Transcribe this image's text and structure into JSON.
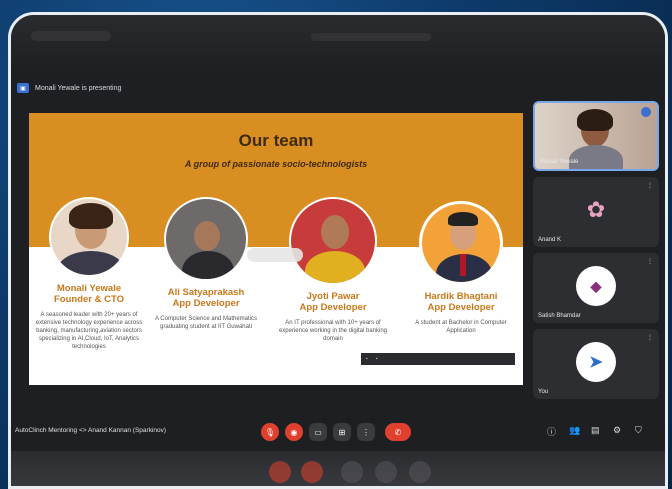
{
  "presenting_banner": "Monali Yewale is presenting",
  "slide": {
    "title": "Our team",
    "subtitle": "A group of passionate socio-technologists",
    "members": [
      {
        "name": "Monali Yewale",
        "role": "Founder & CTO",
        "bio": "A seasoned leader with 20+ years of extensive technology experience across banking, manufacturing,aviation sectors specializing in AI,Cloud, IoT, Analytics technologies"
      },
      {
        "name": "Ali Satyaprakash",
        "role": "App Developer",
        "bio": "A Computer Science and Mathematics graduating student at IIT Guwahati"
      },
      {
        "name": "Jyoti Pawar",
        "role": "App Developer",
        "bio": "An IT professional with 10+ years of experience working in the digital banking domain"
      },
      {
        "name": "Hardik Bhagtani",
        "role": "App Developer",
        "bio": "A student at Bachelor in Computer Application"
      }
    ]
  },
  "participants": [
    {
      "name": "Monali Yewale"
    },
    {
      "name": "Anand K"
    },
    {
      "name": "Satish Bhamdar"
    },
    {
      "name": "You"
    }
  ],
  "meeting_title": "AutoClinch Mentoring <> Anand Kannan (Sparkinov)",
  "controls": {
    "mic_icon": "mic-off-icon",
    "cam_icon": "camera-off-icon",
    "end_call_icon": "end-call-icon"
  },
  "colors": {
    "slide_orange": "#d98e22",
    "accent_red": "#e0412f",
    "name_orange": "#c9781a"
  }
}
